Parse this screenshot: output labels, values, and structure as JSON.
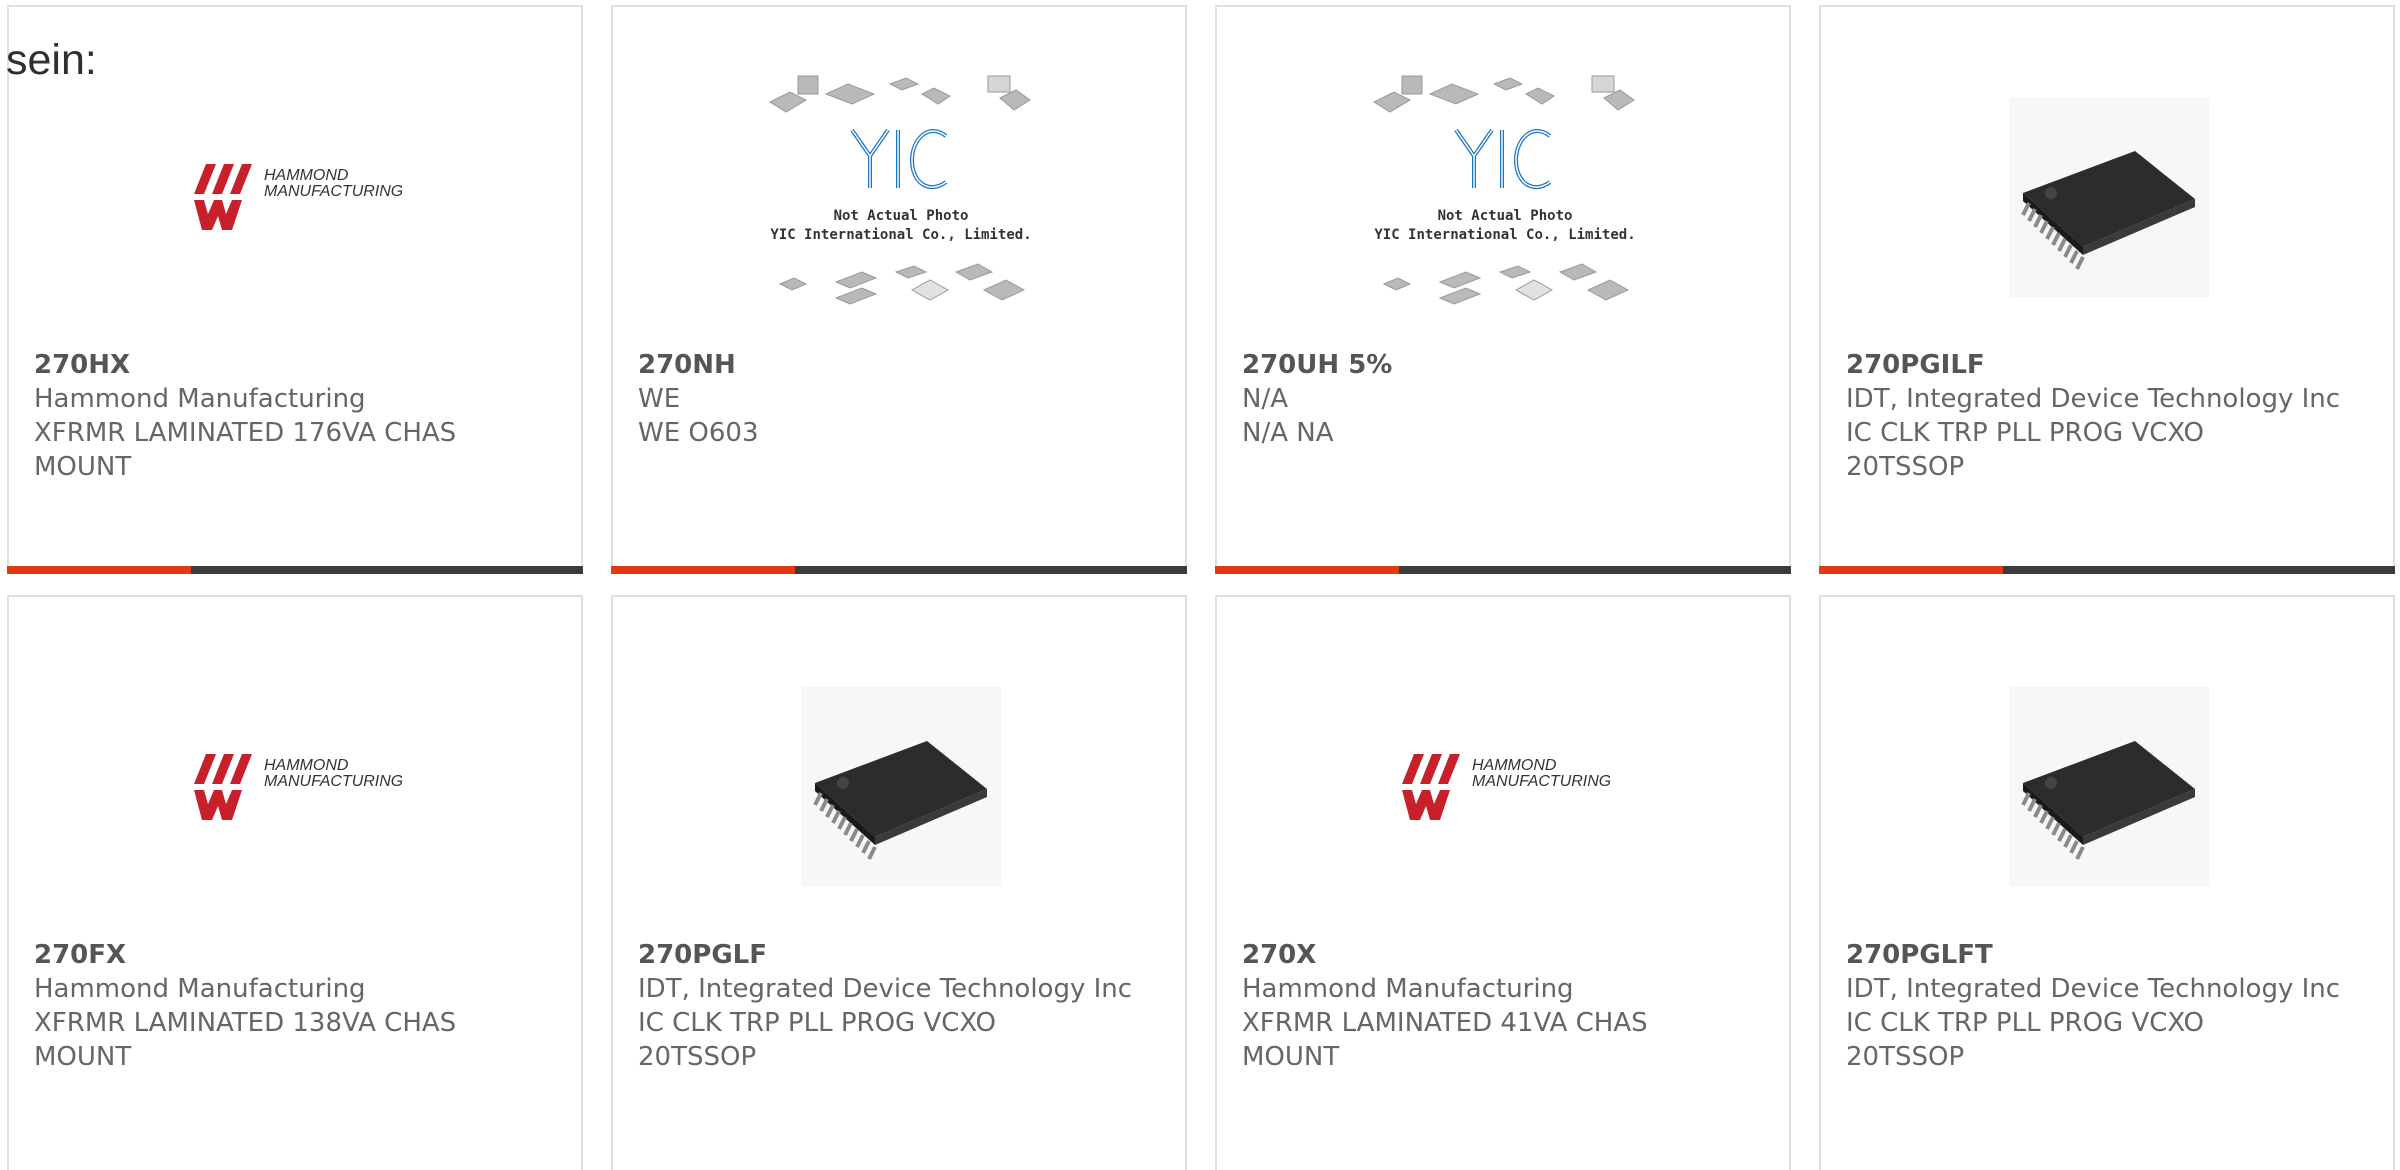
{
  "intro_text": "sein:",
  "colors": {
    "accent": "#e03a12",
    "bar": "#3b3b3b",
    "hammond_red": "#c8202a",
    "yic_blue": "#1a76c8"
  },
  "products": [
    {
      "part": "270HX",
      "manufacturer": "Hammond Manufacturing",
      "description": "XFRMR LAMINATED 176VA CHAS MOUNT",
      "image": "hammond-logo",
      "logo_line1": "HAMMOND",
      "logo_line2": "MANUFACTURING."
    },
    {
      "part": "270NH",
      "manufacturer": "WE",
      "description": "WE O603",
      "image": "yic-placeholder",
      "photo_line1": "Not Actual Photo",
      "photo_line2": "YIC International Co., Limited.",
      "photo_logo": "YIC"
    },
    {
      "part": "270UH 5%",
      "manufacturer": "N/A",
      "description": "N/A NA",
      "image": "yic-placeholder",
      "photo_line1": "Not Actual Photo",
      "photo_line2": "YIC International Co., Limited.",
      "photo_logo": "YIC"
    },
    {
      "part": "270PGILF",
      "manufacturer": "IDT, Integrated Device Technology Inc",
      "description": "IC CLK TRP PLL PROG VCXO 20TSSOP",
      "image": "tssop-chip"
    },
    {
      "part": "270FX",
      "manufacturer": "Hammond Manufacturing",
      "description": "XFRMR LAMINATED 138VA CHAS MOUNT",
      "image": "hammond-logo",
      "logo_line1": "HAMMOND",
      "logo_line2": "MANUFACTURING."
    },
    {
      "part": "270PGLF",
      "manufacturer": "IDT, Integrated Device Technology Inc",
      "description": "IC CLK TRP PLL PROG VCXO 20TSSOP",
      "image": "tssop-chip"
    },
    {
      "part": "270X",
      "manufacturer": "Hammond Manufacturing",
      "description": "XFRMR LAMINATED 41VA CHAS MOUNT",
      "image": "hammond-logo",
      "logo_line1": "HAMMOND",
      "logo_line2": "MANUFACTURING."
    },
    {
      "part": "270PGLFT",
      "manufacturer": "IDT, Integrated Device Technology Inc",
      "description": "IC CLK TRP PLL PROG VCXO 20TSSOP",
      "image": "tssop-chip"
    }
  ]
}
